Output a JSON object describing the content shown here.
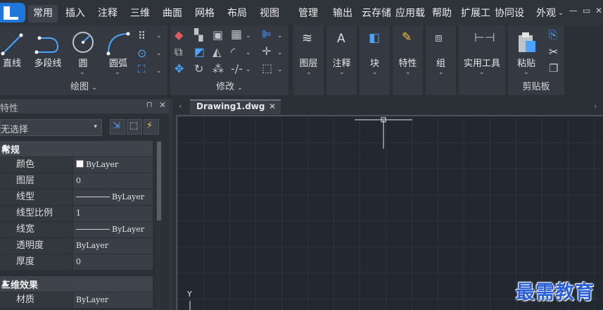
{
  "menubar": {
    "logo": "L",
    "tabs": [
      "常用",
      "插入",
      "注释",
      "三维",
      "曲面",
      "网格",
      "布局",
      "视图",
      "管理",
      "输出",
      "云存储",
      "应用程序",
      "帮助",
      "扩展工具",
      "协同设计"
    ],
    "tabs_shown": [
      "常用",
      "插入",
      "注释",
      "三维",
      "曲面",
      "网格",
      "布局",
      "视图",
      "管理",
      "输出",
      "云存储",
      "应用载",
      "帮助",
      "扩展工",
      "协同设"
    ],
    "active_tab": "常用",
    "appearance": "外观"
  },
  "ribbon": {
    "draw": {
      "title": "绘图",
      "line": "直线",
      "polyline": "多段线",
      "circle": "圆",
      "arc": "圆弧"
    },
    "modify": {
      "title": "修改"
    },
    "layers": "图层",
    "annotate": "注释",
    "block": "块",
    "properties": "特性",
    "group": "组",
    "utilities": "实用工具",
    "clipboard": {
      "title": "剪贴板",
      "paste": "粘贴"
    }
  },
  "properties_panel": {
    "title": "特性",
    "selection": "无选择",
    "general_group": "常规",
    "general_rows": [
      {
        "name": "颜色",
        "value": "ByLayer"
      },
      {
        "name": "图层",
        "value": "0"
      },
      {
        "name": "线型",
        "value": "ByLayer"
      },
      {
        "name": "线型比例",
        "value": "1"
      },
      {
        "name": "线宽",
        "value": "ByLayer"
      },
      {
        "name": "透明度",
        "value": "ByLayer"
      },
      {
        "name": "厚度",
        "value": "0"
      }
    ],
    "effects_group": "三维效果",
    "effects_rows": [
      {
        "name": "材质",
        "value": "ByLayer"
      }
    ]
  },
  "document": {
    "tab_label": "Drawing1.dwg",
    "ucs_y": "Y"
  },
  "watermark": "最需教育",
  "colors": {
    "accent_blue": "#1f77d9",
    "canvas": "#212830",
    "panel": "#353a42",
    "watermark": "#2a5fd6"
  }
}
